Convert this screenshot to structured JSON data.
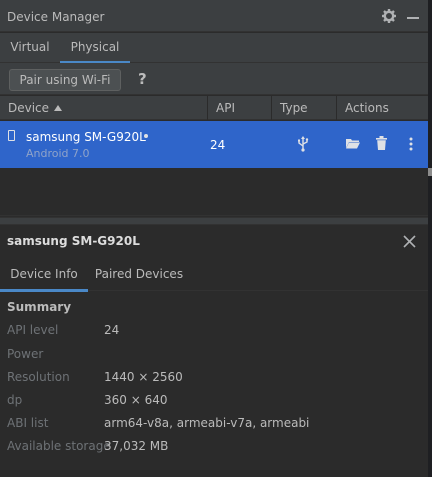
{
  "window": {
    "title": "Device Manager",
    "icons": {
      "settings": "gear-icon",
      "minimize": "minimize-icon"
    }
  },
  "device_tabs": [
    {
      "label": "Virtual",
      "active": false
    },
    {
      "label": "Physical",
      "active": true
    }
  ],
  "toolbar": {
    "pair_label": "Pair using Wi-Fi",
    "help_label": "?"
  },
  "table": {
    "columns": {
      "device": "Device",
      "api": "API",
      "type": "Type",
      "actions": "Actions"
    },
    "sort": {
      "column": "Device",
      "direction": "ascending"
    },
    "rows": [
      {
        "name": "samsung SM-G920L",
        "os": "Android 7.0",
        "api": "24",
        "type_icon": "usb-icon",
        "online": true,
        "action_icons": [
          "folder-icon",
          "trash-icon",
          "more-vertical-icon"
        ],
        "selected": true
      }
    ]
  },
  "details": {
    "title": "samsung SM-G920L",
    "tabs": [
      {
        "label": "Device Info",
        "active": true
      },
      {
        "label": "Paired Devices",
        "active": false
      }
    ],
    "summary_heading": "Summary",
    "properties": [
      {
        "label": "API level",
        "value": "24"
      },
      {
        "label": "Power",
        "value": ""
      },
      {
        "label": "Resolution",
        "value": "1440 × 2560"
      },
      {
        "label": "dp",
        "value": "360 × 640"
      },
      {
        "label": "ABI list",
        "value": "arm64-v8a, armeabi-v7a, armeabi"
      },
      {
        "label": "Available storage",
        "value": "37,032 MB"
      }
    ]
  },
  "colors": {
    "panel_bg": "#2b2b2b",
    "toolbar_bg": "#3c3f41",
    "selection": "#2f65ca",
    "tab_underline": "#4a88c7"
  }
}
